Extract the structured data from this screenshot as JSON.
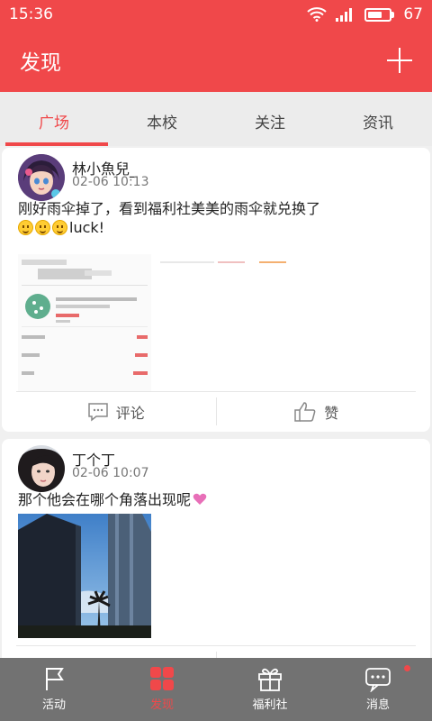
{
  "status_bar": {
    "time": "15:36",
    "battery": "67",
    "battery_level": 0.67
  },
  "header": {
    "title": "发现"
  },
  "tabs": [
    {
      "label": "广场",
      "active": true
    },
    {
      "label": "本校",
      "active": false
    },
    {
      "label": "关注",
      "active": false
    },
    {
      "label": "资讯",
      "active": false
    }
  ],
  "posts": [
    {
      "username": "林小魚兒_",
      "time": "02-06 10:13",
      "text": "刚好雨伞掉了，看到福利社美美的雨伞就兑换了",
      "text_suffix": "luck!",
      "comment_label": "评论",
      "like_label": "赞"
    },
    {
      "username": "丁个丁",
      "time": "02-06 10:07",
      "text": "那个他会在哪个角落出现呢"
    }
  ],
  "bottom_nav": [
    {
      "label": "活动",
      "icon": "flag-icon",
      "active": false
    },
    {
      "label": "发现",
      "icon": "grid-icon",
      "active": true
    },
    {
      "label": "福利社",
      "icon": "gift-icon",
      "active": false
    },
    {
      "label": "消息",
      "icon": "message-icon",
      "active": false,
      "badge": true
    }
  ],
  "colors": {
    "accent": "#f0484a",
    "nav_bg": "#727272"
  }
}
